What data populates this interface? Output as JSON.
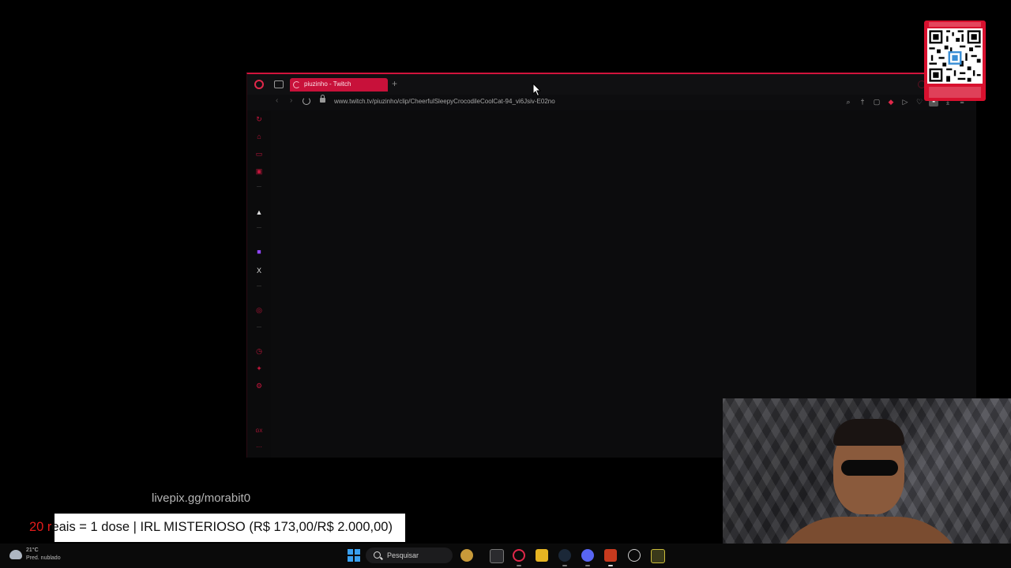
{
  "browser": {
    "tab_title": "piuzinho - Twitch",
    "new_tab_label": "+",
    "url": "www.twitch.tv/piuzinho/clip/CheerfulSleepyCrocodileCoolCat-94_vi6Jsiv-E02no",
    "accent_color": "#d2143c"
  },
  "sidebar": {
    "items": [
      "history-icon",
      "bag-icon",
      "chat-icon",
      "inbox-icon",
      "nav-icon",
      "twitch-icon",
      "x-icon",
      "player-icon",
      "clock-icon",
      "puzzle-icon",
      "settings-icon",
      "gx-icon",
      "more-icon"
    ],
    "x_label": "X",
    "gx_label": "GX",
    "more_label": "···"
  },
  "overlay": {
    "livepix": "livepix.gg/morabit0",
    "donation_prefix": "20 r",
    "donation_text": "eais = 1 dose | IRL MISTERIOSO (R$ 173,00/R$ 2.000,00)"
  },
  "taskbar": {
    "temperature": "21°C",
    "condition": "Pred. nublado",
    "search_placeholder": "Pesquisar"
  }
}
